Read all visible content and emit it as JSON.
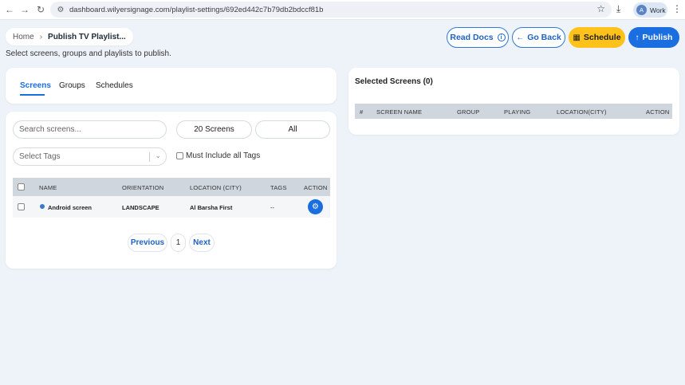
{
  "browser": {
    "url": "dashboard.wilyersignage.com/playlist-settings/692ed442c7b79db2bdccf81b",
    "profile_initial": "A",
    "profile_label": "Work"
  },
  "breadcrumb": {
    "home": "Home",
    "current": "Publish TV Playlist..."
  },
  "subtitle": "Select screens, groups and playlists to publish.",
  "header_buttons": {
    "read_docs": "Read Docs",
    "go_back": "Go Back",
    "schedule": "Schedule",
    "publish": "Publish"
  },
  "tabs": [
    {
      "label": "Screens",
      "active": true
    },
    {
      "label": "Groups",
      "active": false
    },
    {
      "label": "Schedules",
      "active": false
    }
  ],
  "filters": {
    "search_placeholder": "Search screens...",
    "screen_count": "20 Screens",
    "type_filter": "All",
    "tags_placeholder": "Select Tags",
    "must_include_label": "Must Include all Tags"
  },
  "screens_table": {
    "columns": [
      "NAME",
      "ORIENTATION",
      "LOCATION (CITY)",
      "TAGS",
      "ACTION"
    ],
    "rows": [
      {
        "name": "Android screen",
        "orientation": "LANDSCAPE",
        "location": "Al Barsha First",
        "tags": "--"
      }
    ]
  },
  "pagination": {
    "previous": "Previous",
    "page": "1",
    "next": "Next"
  },
  "selected": {
    "title": "Selected Screens (0)",
    "columns": [
      "#",
      "SCREEN NAME",
      "GROUP",
      "PLAYING",
      "LOCATION(CITY)",
      "ACTION"
    ]
  },
  "colors": {
    "primary": "#1a6ee0",
    "schedule": "#ffc21a",
    "background": "#eef3f9",
    "table_header": "#d0d6de"
  }
}
